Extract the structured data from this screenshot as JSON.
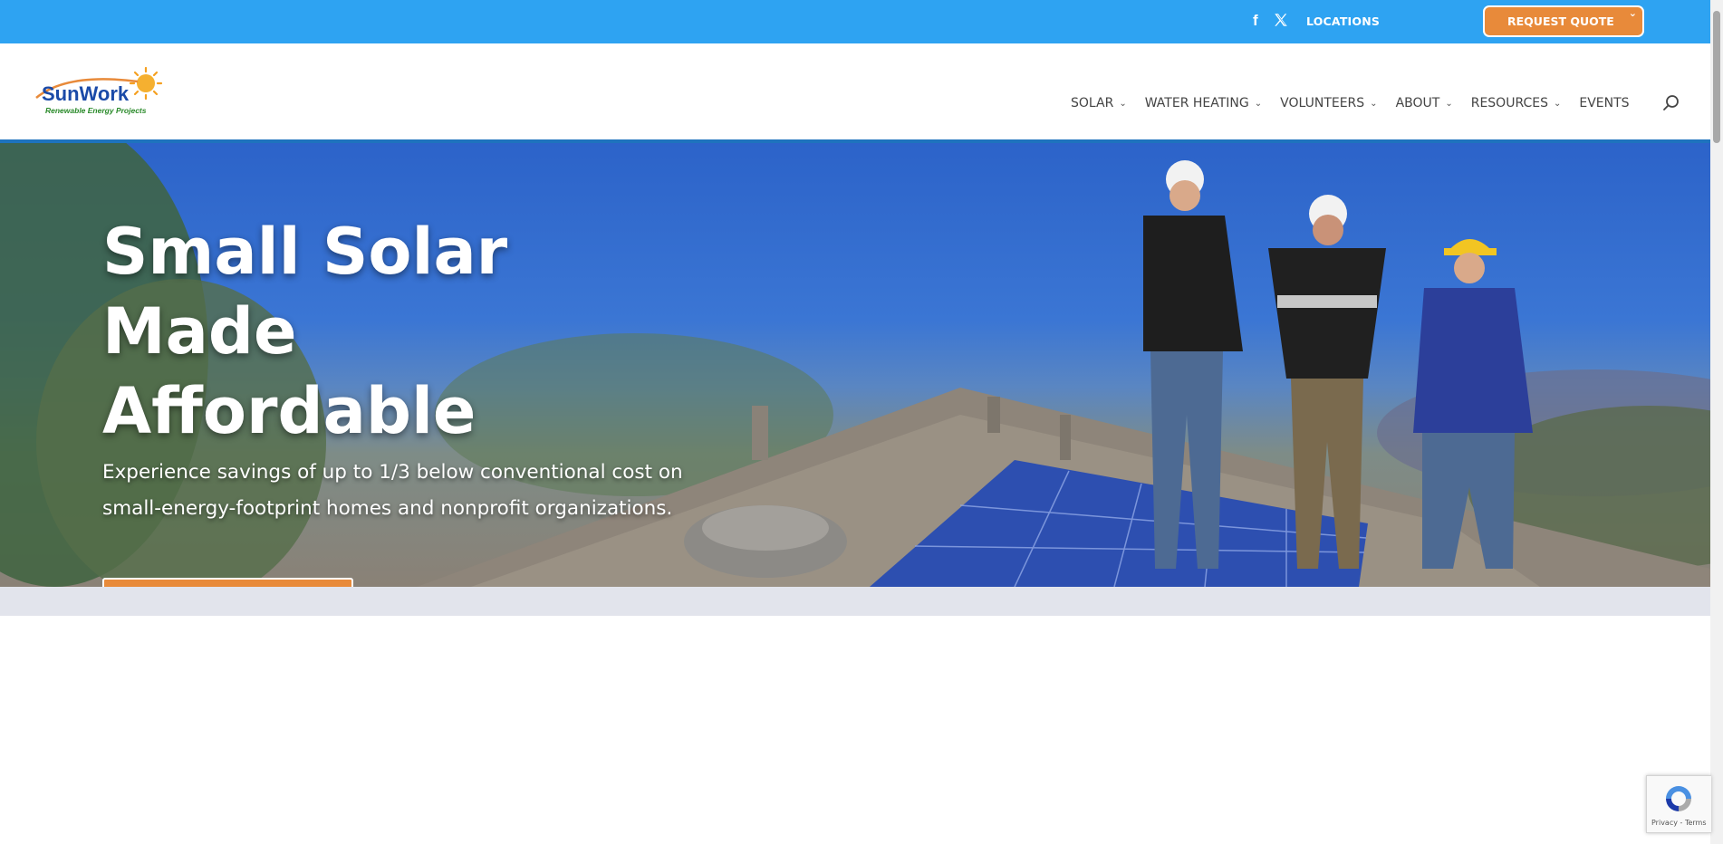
{
  "topbar": {
    "facebook_icon": "f",
    "locations_label": "LOCATIONS",
    "quote_label": "REQUEST QUOTE",
    "accent": "#2ea3f2",
    "button_color": "#e88a3a"
  },
  "header": {
    "logo": {
      "brand": "SunWork",
      "tagline": "Renewable Energy Projects"
    },
    "nav": [
      {
        "label": "SOLAR",
        "has_dropdown": true
      },
      {
        "label": "WATER HEATING",
        "has_dropdown": true
      },
      {
        "label": "VOLUNTEERS",
        "has_dropdown": true
      },
      {
        "label": "ABOUT",
        "has_dropdown": true
      },
      {
        "label": "RESOURCES",
        "has_dropdown": true
      },
      {
        "label": "EVENTS",
        "has_dropdown": false
      }
    ],
    "border_color": "#1e73be"
  },
  "hero": {
    "title_lines": [
      "Small Solar",
      "Made",
      "Affordable"
    ],
    "subtitle": "Experience savings of up to 1/3 below conventional cost on small-energy-footprint homes and nonprofit organizations."
  },
  "recaptcha": {
    "links": "Privacy - Terms"
  }
}
